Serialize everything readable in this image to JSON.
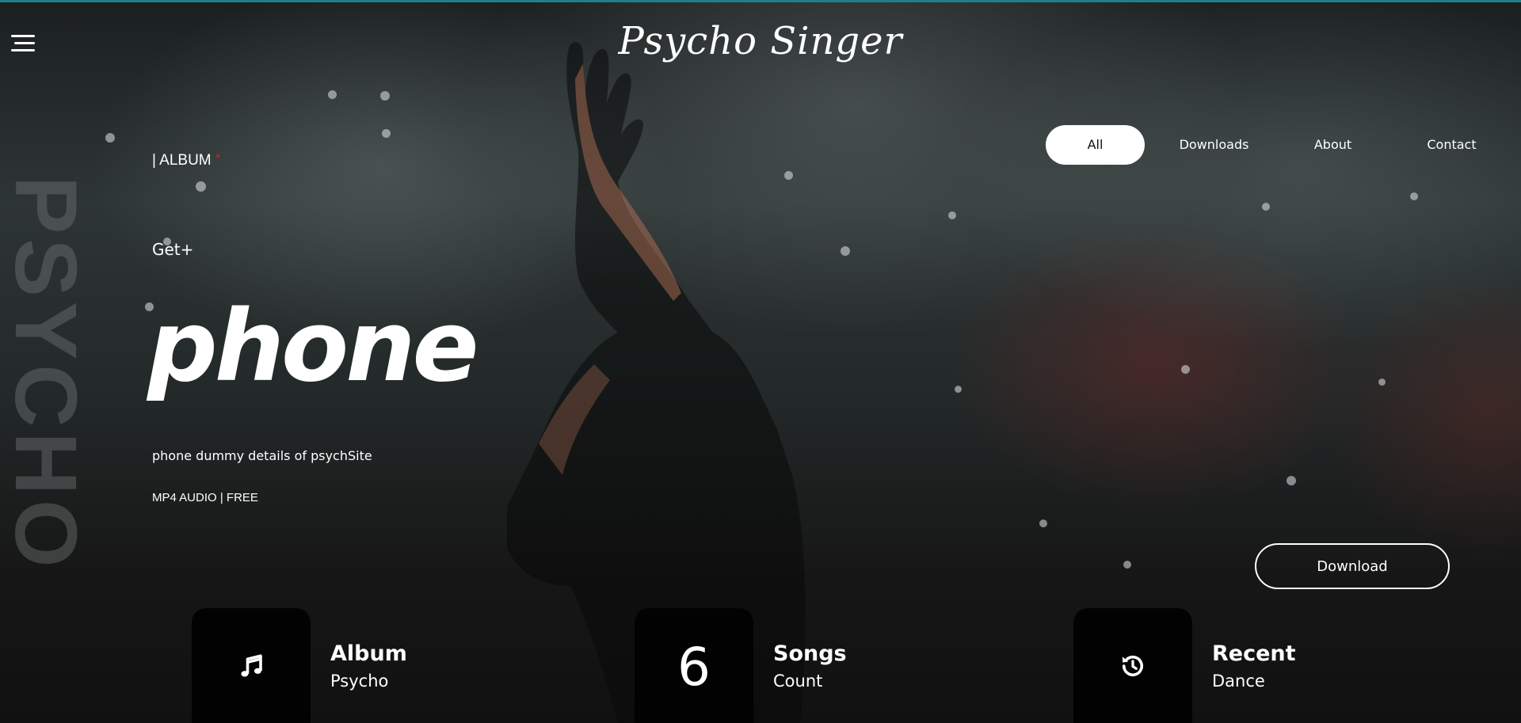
{
  "header": {
    "logo_text": "Psycho Singer",
    "menu_icon": "hamburger-menu-icon"
  },
  "side_text": "PSYCHO",
  "nav": {
    "items": [
      {
        "label": "All",
        "active": true
      },
      {
        "label": "Downloads",
        "active": false
      },
      {
        "label": "About",
        "active": false
      },
      {
        "label": "Contact",
        "active": false
      }
    ]
  },
  "hero": {
    "category": "| ALBUM",
    "category_marker": "*",
    "get_label": "Get+",
    "title": "phone",
    "description": "phone dummy details of psychSite",
    "meta": "MP4 AUDIO | FREE"
  },
  "download_button": {
    "label": "Download"
  },
  "stats": [
    {
      "icon": "music-note-icon",
      "title": "Album",
      "subtitle": "Psycho"
    },
    {
      "number": "6",
      "title": "Songs",
      "subtitle": "Count"
    },
    {
      "icon": "history-icon",
      "title": "Recent",
      "subtitle": "Dance"
    }
  ],
  "colors": {
    "accent_line": "#1f7f86",
    "marker_red": "#e11d1d",
    "stat_box": "#020202"
  }
}
